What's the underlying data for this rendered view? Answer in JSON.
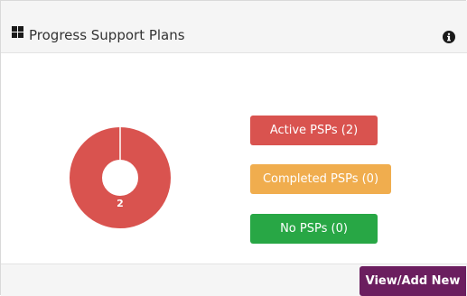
{
  "header": {
    "title": "Progress Support Plans",
    "title_icon": "grid-icon",
    "info_icon": "info-icon"
  },
  "chart_data": {
    "type": "pie",
    "categories": [
      "Active PSPs",
      "Completed PSPs",
      "No PSPs"
    ],
    "values": [
      2,
      0,
      0
    ],
    "data_labels": [
      "2"
    ],
    "colors": [
      "#d9534f",
      "#f0ad4e",
      "#28a745"
    ],
    "donut": true
  },
  "legend": {
    "items": [
      {
        "label": "Active PSPs (2)",
        "color": "#d9534f"
      },
      {
        "label": "Completed PSPs (0)",
        "color": "#f0ad4e"
      },
      {
        "label": "No PSPs (0)",
        "color": "#28a745"
      }
    ]
  },
  "footer": {
    "view_add_label": "View/Add New",
    "view_add_color": "#6b1e5f"
  }
}
